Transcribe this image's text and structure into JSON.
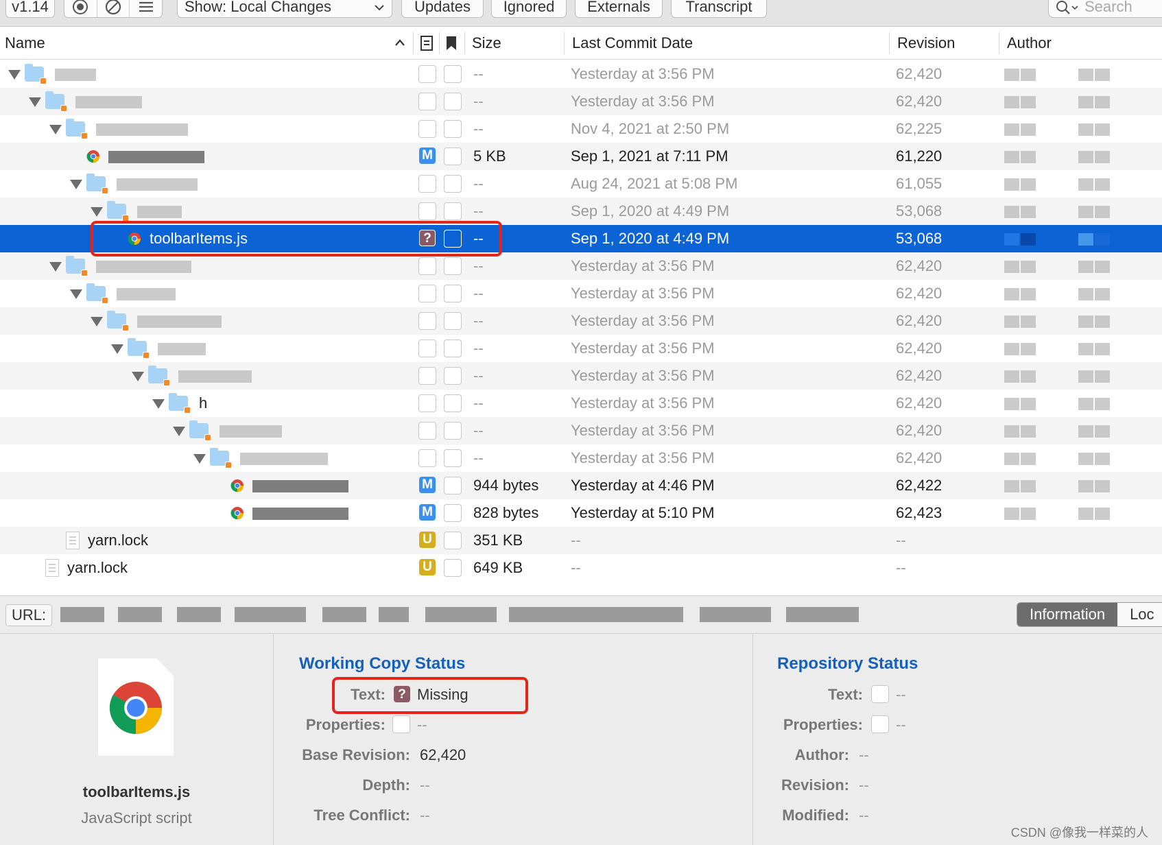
{
  "toolbar": {
    "version": "v1.14",
    "show_label": "Show: Local Changes",
    "updates": "Updates",
    "ignored": "Ignored",
    "externals": "Externals",
    "transcript": "Transcript",
    "search_placeholder": "Search"
  },
  "columns": {
    "name": "Name",
    "size": "Size",
    "last_commit_date": "Last Commit Date",
    "revision": "Revision",
    "author": "Author"
  },
  "rows": [
    {
      "depth": 0,
      "kind": "folder",
      "name": "",
      "status": "",
      "size": "--",
      "date": "Yesterday at 3:56 PM",
      "revision": "62,420",
      "bold": false
    },
    {
      "depth": 1,
      "kind": "folder",
      "name": "",
      "status": "",
      "size": "--",
      "date": "Yesterday at 3:56 PM",
      "revision": "62,420",
      "bold": false
    },
    {
      "depth": 2,
      "kind": "folder",
      "name": "",
      "status": "",
      "size": "--",
      "date": "Nov 4, 2021 at 2:50 PM",
      "revision": "62,225",
      "bold": false
    },
    {
      "depth": 3,
      "kind": "file",
      "name": "",
      "status": "M",
      "size": "5 KB",
      "date": "Sep 1, 2021 at 7:11 PM",
      "revision": "61,220",
      "bold": true
    },
    {
      "depth": 3,
      "kind": "folder",
      "name": "",
      "status": "",
      "size": "--",
      "date": "Aug 24, 2021 at 5:08 PM",
      "revision": "61,055",
      "bold": false
    },
    {
      "depth": 4,
      "kind": "folder",
      "name": "",
      "status": "",
      "size": "--",
      "date": "Sep 1, 2020 at 4:49 PM",
      "revision": "53,068",
      "bold": false
    },
    {
      "depth": 5,
      "kind": "file",
      "name": "toolbarItems.js",
      "status": "?",
      "size": "--",
      "date": "Sep 1, 2020 at 4:49 PM",
      "revision": "53,068",
      "bold": false,
      "selected": true
    },
    {
      "depth": 2,
      "kind": "folder",
      "name": "",
      "status": "",
      "size": "--",
      "date": "Yesterday at 3:56 PM",
      "revision": "62,420",
      "bold": false
    },
    {
      "depth": 3,
      "kind": "folder",
      "name": "",
      "status": "",
      "size": "--",
      "date": "Yesterday at 3:56 PM",
      "revision": "62,420",
      "bold": false
    },
    {
      "depth": 4,
      "kind": "folder",
      "name": "",
      "status": "",
      "size": "--",
      "date": "Yesterday at 3:56 PM",
      "revision": "62,420",
      "bold": false
    },
    {
      "depth": 5,
      "kind": "folder",
      "name": "",
      "status": "",
      "size": "--",
      "date": "Yesterday at 3:56 PM",
      "revision": "62,420",
      "bold": false
    },
    {
      "depth": 6,
      "kind": "folder",
      "name": "",
      "status": "",
      "size": "--",
      "date": "Yesterday at 3:56 PM",
      "revision": "62,420",
      "bold": false
    },
    {
      "depth": 7,
      "kind": "folder",
      "name": "h",
      "status": "",
      "size": "--",
      "date": "Yesterday at 3:56 PM",
      "revision": "62,420",
      "bold": false
    },
    {
      "depth": 8,
      "kind": "folder",
      "name": "",
      "status": "",
      "size": "--",
      "date": "Yesterday at 3:56 PM",
      "revision": "62,420",
      "bold": false
    },
    {
      "depth": 9,
      "kind": "folder",
      "name": "",
      "status": "",
      "size": "--",
      "date": "Yesterday at 3:56 PM",
      "revision": "62,420",
      "bold": false
    },
    {
      "depth": 10,
      "kind": "file",
      "name": "",
      "status": "M",
      "size": "944 bytes",
      "date": "Yesterday at 4:46 PM",
      "revision": "62,422",
      "bold": true
    },
    {
      "depth": 10,
      "kind": "file",
      "name": "",
      "status": "M",
      "size": "828 bytes",
      "date": "Yesterday at 5:10 PM",
      "revision": "62,423",
      "bold": true
    },
    {
      "depth": 2,
      "kind": "text",
      "name": "yarn.lock",
      "status": "U",
      "size": "351 KB",
      "date": "--",
      "revision": "--",
      "bold": false
    },
    {
      "depth": 1,
      "kind": "text",
      "name": "yarn.lock",
      "status": "U",
      "size": "649 KB",
      "date": "--",
      "revision": "--",
      "bold": false
    }
  ],
  "urlbar": {
    "label": "URL:",
    "tab_information": "Information",
    "tab_log": "Loc"
  },
  "info": {
    "file_name": "toolbarItems.js",
    "file_kind": "JavaScript script",
    "working_copy": {
      "title": "Working Copy Status",
      "text_label": "Text:",
      "text_badge": "?",
      "text_value": "Missing",
      "properties_label": "Properties:",
      "properties_value": "--",
      "base_revision_label": "Base Revision:",
      "base_revision_value": "62,420",
      "depth_label": "Depth:",
      "depth_value": "--",
      "tree_conflict_label": "Tree Conflict:",
      "tree_conflict_value": "--"
    },
    "repository": {
      "title": "Repository Status",
      "text_label": "Text:",
      "text_value": "--",
      "properties_label": "Properties:",
      "properties_value": "--",
      "author_label": "Author:",
      "author_value": "--",
      "revision_label": "Revision:",
      "revision_value": "--",
      "modified_label": "Modified:",
      "modified_value": "--"
    }
  },
  "watermark": "CSDN @像我一样菜的人",
  "colors": {
    "selection": "#0b63d6",
    "highlight": "#e3261c",
    "section_title": "#1560bd",
    "badge_modified": "#3b8ff0",
    "badge_unversioned": "#d4ae1f",
    "badge_missing": "#8c5a64"
  }
}
